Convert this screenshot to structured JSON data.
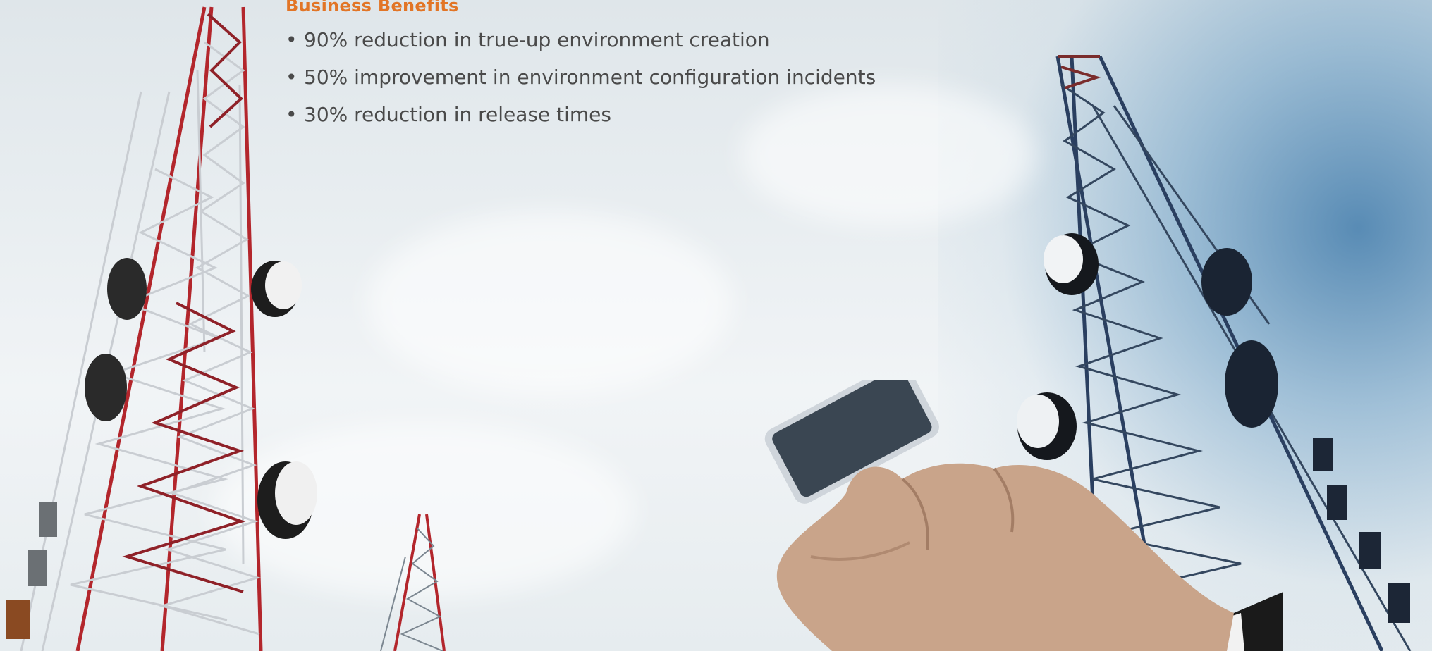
{
  "benefits_section": {
    "heading": "Business Benefits",
    "items": [
      "90% reduction in true-up environment creation",
      "50% improvement in environment configuration incidents",
      "30% reduction in release times"
    ],
    "heading_color": "#e27526",
    "text_color": "#4a4a4a"
  },
  "image": {
    "subject": [
      "telecom-tower-left",
      "telecom-tower-small",
      "telecom-tower-right",
      "hand-holding-phone"
    ],
    "colors": {
      "tower_red": "#b3262c",
      "tower_steel": "#c9cdd2",
      "tower_blue": "#2a3f60",
      "sky_blue": "#3f7aaa"
    }
  }
}
